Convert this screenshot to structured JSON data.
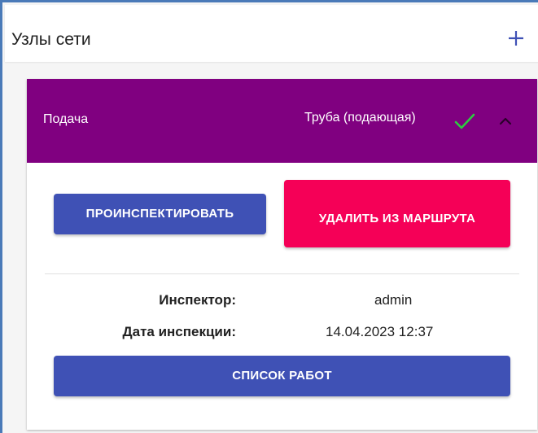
{
  "panel": {
    "title": "Узлы сети",
    "add_icon": "plus-icon"
  },
  "node": {
    "name": "Подача",
    "type_label": "Труба (подающая)",
    "status_icon": "check-icon",
    "expand_icon": "chevron-up-icon",
    "header_color": "#800080",
    "status_color": "#2ecc40"
  },
  "actions": {
    "inspect_label": "ПРОИНСПЕКТИРОВАТЬ",
    "remove_label": "УДАЛИТЬ ИЗ МАРШРУТА",
    "works_label": "СПИСОК РАБОТ",
    "primary_color": "#3f51b5",
    "danger_color": "#f50057"
  },
  "inspection": {
    "inspector_label": "Инспектор:",
    "inspector_value": "admin",
    "date_label": "Дата инспекции:",
    "date_value": "14.04.2023 12:37"
  }
}
